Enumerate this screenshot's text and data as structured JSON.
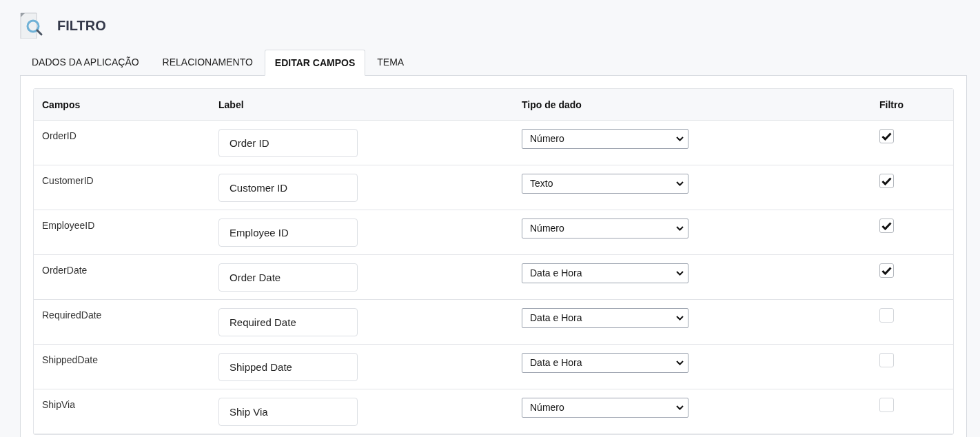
{
  "page": {
    "title": "FILTRO"
  },
  "tabs": [
    {
      "label": "DADOS DA APLICAÇÃO",
      "selected": false
    },
    {
      "label": "RELACIONAMENTO",
      "selected": false
    },
    {
      "label": "EDITAR CAMPOS",
      "selected": true
    },
    {
      "label": "TEMA",
      "selected": false
    }
  ],
  "table": {
    "columns": [
      "Campos",
      "Label",
      "Tipo de dado",
      "Filtro"
    ],
    "rows": [
      {
        "field": "OrderID",
        "label": "Order ID",
        "type": "Número",
        "filter": true
      },
      {
        "field": "CustomerID",
        "label": "Customer ID",
        "type": "Texto",
        "filter": true
      },
      {
        "field": "EmployeeID",
        "label": "Employee ID",
        "type": "Número",
        "filter": true
      },
      {
        "field": "OrderDate",
        "label": "Order Date",
        "type": "Data e Hora",
        "filter": true
      },
      {
        "field": "RequiredDate",
        "label": "Required Date",
        "type": "Data e Hora",
        "filter": false
      },
      {
        "field": "ShippedDate",
        "label": "Shipped Date",
        "type": "Data e Hora",
        "filter": false
      },
      {
        "field": "ShipVia",
        "label": "Ship Via",
        "type": "Número",
        "filter": false
      }
    ]
  }
}
